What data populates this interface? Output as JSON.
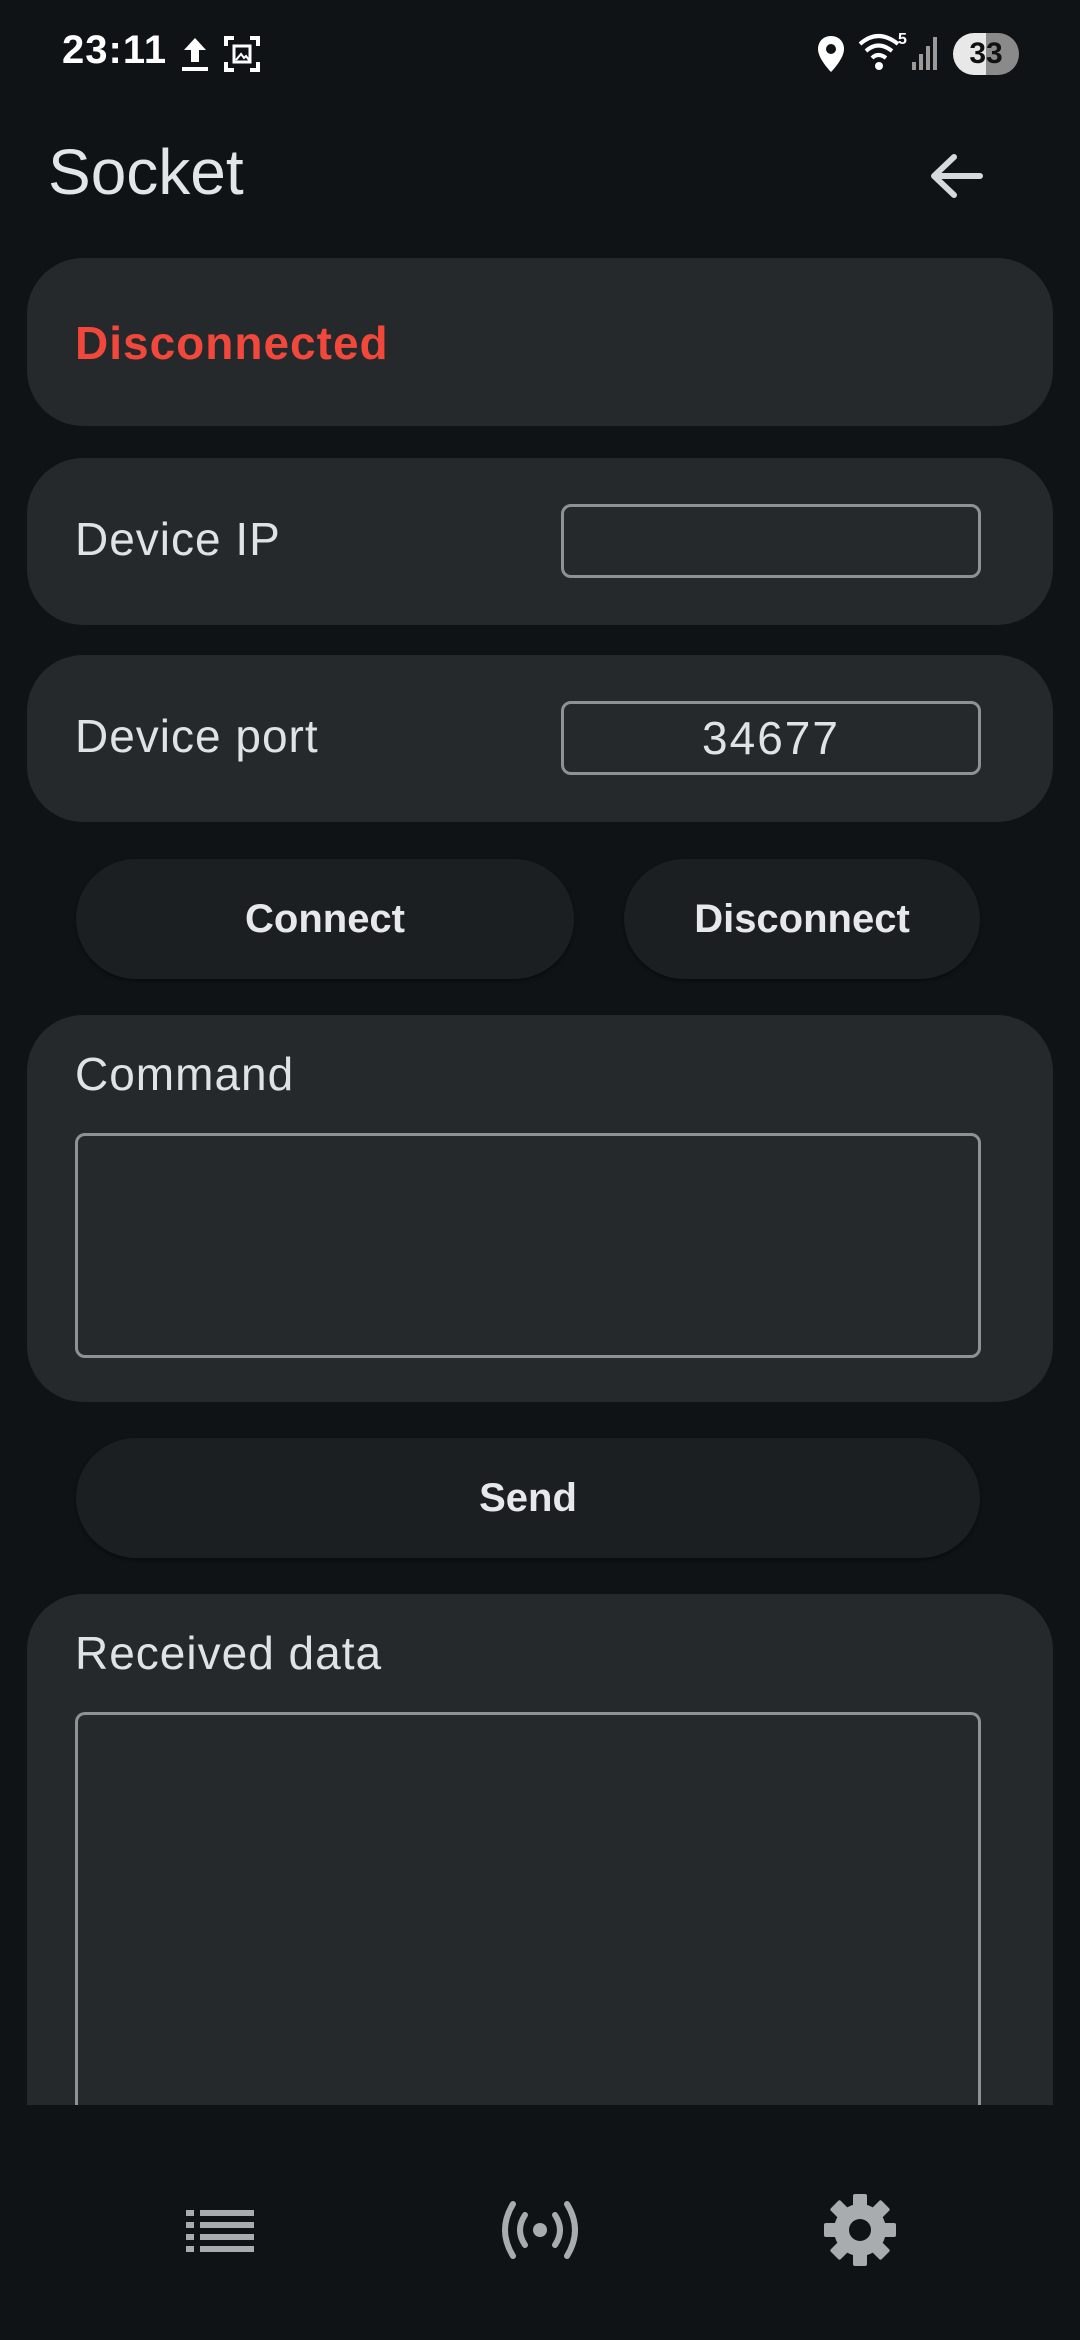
{
  "status_bar": {
    "time": "23:11",
    "battery": "33",
    "wifi_badge": "5",
    "icons": [
      "upload-icon",
      "screenshot-icon",
      "location-icon",
      "wifi-icon",
      "signal-icon",
      "battery-icon"
    ]
  },
  "app_bar": {
    "title": "Socket",
    "back_icon": "arrow-back-icon"
  },
  "connection": {
    "status": "Disconnected",
    "status_color": "#f2473b"
  },
  "fields": {
    "ip_label": "Device IP",
    "ip_value": "",
    "port_label": "Device port",
    "port_value": "34677"
  },
  "buttons": {
    "connect": "Connect",
    "disconnect": "Disconnect",
    "send": "Send"
  },
  "command": {
    "label": "Command",
    "value": ""
  },
  "received": {
    "label": "Received data",
    "value": ""
  },
  "bottom_nav": {
    "items": [
      {
        "icon": "list-icon"
      },
      {
        "icon": "broadcast-icon"
      },
      {
        "icon": "gear-icon"
      }
    ]
  }
}
